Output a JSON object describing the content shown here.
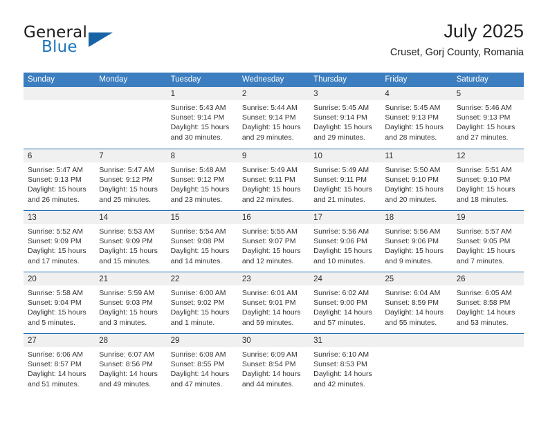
{
  "brand": {
    "name_top": "General",
    "name_bottom": "Blue",
    "triangle_color": "#1763A6",
    "blue_color": "#1F76BC"
  },
  "header": {
    "title": "July 2025",
    "subtitle": "Cruset, Gorj County, Romania"
  },
  "theme": {
    "header_bar": "#3C7EBF",
    "week_separator": "#1F6FB5",
    "daynum_strip": "#F0F0F0"
  },
  "weekdays": [
    "Sunday",
    "Monday",
    "Tuesday",
    "Wednesday",
    "Thursday",
    "Friday",
    "Saturday"
  ],
  "weeks": [
    [
      {
        "day": "",
        "empty": true
      },
      {
        "day": "",
        "empty": true
      },
      {
        "day": "1",
        "sunrise": "Sunrise: 5:43 AM",
        "sunset": "Sunset: 9:14 PM",
        "daylight1": "Daylight: 15 hours",
        "daylight2": "and 30 minutes."
      },
      {
        "day": "2",
        "sunrise": "Sunrise: 5:44 AM",
        "sunset": "Sunset: 9:14 PM",
        "daylight1": "Daylight: 15 hours",
        "daylight2": "and 29 minutes."
      },
      {
        "day": "3",
        "sunrise": "Sunrise: 5:45 AM",
        "sunset": "Sunset: 9:14 PM",
        "daylight1": "Daylight: 15 hours",
        "daylight2": "and 29 minutes."
      },
      {
        "day": "4",
        "sunrise": "Sunrise: 5:45 AM",
        "sunset": "Sunset: 9:13 PM",
        "daylight1": "Daylight: 15 hours",
        "daylight2": "and 28 minutes."
      },
      {
        "day": "5",
        "sunrise": "Sunrise: 5:46 AM",
        "sunset": "Sunset: 9:13 PM",
        "daylight1": "Daylight: 15 hours",
        "daylight2": "and 27 minutes."
      }
    ],
    [
      {
        "day": "6",
        "sunrise": "Sunrise: 5:47 AM",
        "sunset": "Sunset: 9:13 PM",
        "daylight1": "Daylight: 15 hours",
        "daylight2": "and 26 minutes."
      },
      {
        "day": "7",
        "sunrise": "Sunrise: 5:47 AM",
        "sunset": "Sunset: 9:12 PM",
        "daylight1": "Daylight: 15 hours",
        "daylight2": "and 25 minutes."
      },
      {
        "day": "8",
        "sunrise": "Sunrise: 5:48 AM",
        "sunset": "Sunset: 9:12 PM",
        "daylight1": "Daylight: 15 hours",
        "daylight2": "and 23 minutes."
      },
      {
        "day": "9",
        "sunrise": "Sunrise: 5:49 AM",
        "sunset": "Sunset: 9:11 PM",
        "daylight1": "Daylight: 15 hours",
        "daylight2": "and 22 minutes."
      },
      {
        "day": "10",
        "sunrise": "Sunrise: 5:49 AM",
        "sunset": "Sunset: 9:11 PM",
        "daylight1": "Daylight: 15 hours",
        "daylight2": "and 21 minutes."
      },
      {
        "day": "11",
        "sunrise": "Sunrise: 5:50 AM",
        "sunset": "Sunset: 9:10 PM",
        "daylight1": "Daylight: 15 hours",
        "daylight2": "and 20 minutes."
      },
      {
        "day": "12",
        "sunrise": "Sunrise: 5:51 AM",
        "sunset": "Sunset: 9:10 PM",
        "daylight1": "Daylight: 15 hours",
        "daylight2": "and 18 minutes."
      }
    ],
    [
      {
        "day": "13",
        "sunrise": "Sunrise: 5:52 AM",
        "sunset": "Sunset: 9:09 PM",
        "daylight1": "Daylight: 15 hours",
        "daylight2": "and 17 minutes."
      },
      {
        "day": "14",
        "sunrise": "Sunrise: 5:53 AM",
        "sunset": "Sunset: 9:09 PM",
        "daylight1": "Daylight: 15 hours",
        "daylight2": "and 15 minutes."
      },
      {
        "day": "15",
        "sunrise": "Sunrise: 5:54 AM",
        "sunset": "Sunset: 9:08 PM",
        "daylight1": "Daylight: 15 hours",
        "daylight2": "and 14 minutes."
      },
      {
        "day": "16",
        "sunrise": "Sunrise: 5:55 AM",
        "sunset": "Sunset: 9:07 PM",
        "daylight1": "Daylight: 15 hours",
        "daylight2": "and 12 minutes."
      },
      {
        "day": "17",
        "sunrise": "Sunrise: 5:56 AM",
        "sunset": "Sunset: 9:06 PM",
        "daylight1": "Daylight: 15 hours",
        "daylight2": "and 10 minutes."
      },
      {
        "day": "18",
        "sunrise": "Sunrise: 5:56 AM",
        "sunset": "Sunset: 9:06 PM",
        "daylight1": "Daylight: 15 hours",
        "daylight2": "and 9 minutes."
      },
      {
        "day": "19",
        "sunrise": "Sunrise: 5:57 AM",
        "sunset": "Sunset: 9:05 PM",
        "daylight1": "Daylight: 15 hours",
        "daylight2": "and 7 minutes."
      }
    ],
    [
      {
        "day": "20",
        "sunrise": "Sunrise: 5:58 AM",
        "sunset": "Sunset: 9:04 PM",
        "daylight1": "Daylight: 15 hours",
        "daylight2": "and 5 minutes."
      },
      {
        "day": "21",
        "sunrise": "Sunrise: 5:59 AM",
        "sunset": "Sunset: 9:03 PM",
        "daylight1": "Daylight: 15 hours",
        "daylight2": "and 3 minutes."
      },
      {
        "day": "22",
        "sunrise": "Sunrise: 6:00 AM",
        "sunset": "Sunset: 9:02 PM",
        "daylight1": "Daylight: 15 hours",
        "daylight2": "and 1 minute."
      },
      {
        "day": "23",
        "sunrise": "Sunrise: 6:01 AM",
        "sunset": "Sunset: 9:01 PM",
        "daylight1": "Daylight: 14 hours",
        "daylight2": "and 59 minutes."
      },
      {
        "day": "24",
        "sunrise": "Sunrise: 6:02 AM",
        "sunset": "Sunset: 9:00 PM",
        "daylight1": "Daylight: 14 hours",
        "daylight2": "and 57 minutes."
      },
      {
        "day": "25",
        "sunrise": "Sunrise: 6:04 AM",
        "sunset": "Sunset: 8:59 PM",
        "daylight1": "Daylight: 14 hours",
        "daylight2": "and 55 minutes."
      },
      {
        "day": "26",
        "sunrise": "Sunrise: 6:05 AM",
        "sunset": "Sunset: 8:58 PM",
        "daylight1": "Daylight: 14 hours",
        "daylight2": "and 53 minutes."
      }
    ],
    [
      {
        "day": "27",
        "sunrise": "Sunrise: 6:06 AM",
        "sunset": "Sunset: 8:57 PM",
        "daylight1": "Daylight: 14 hours",
        "daylight2": "and 51 minutes."
      },
      {
        "day": "28",
        "sunrise": "Sunrise: 6:07 AM",
        "sunset": "Sunset: 8:56 PM",
        "daylight1": "Daylight: 14 hours",
        "daylight2": "and 49 minutes."
      },
      {
        "day": "29",
        "sunrise": "Sunrise: 6:08 AM",
        "sunset": "Sunset: 8:55 PM",
        "daylight1": "Daylight: 14 hours",
        "daylight2": "and 47 minutes."
      },
      {
        "day": "30",
        "sunrise": "Sunrise: 6:09 AM",
        "sunset": "Sunset: 8:54 PM",
        "daylight1": "Daylight: 14 hours",
        "daylight2": "and 44 minutes."
      },
      {
        "day": "31",
        "sunrise": "Sunrise: 6:10 AM",
        "sunset": "Sunset: 8:53 PM",
        "daylight1": "Daylight: 14 hours",
        "daylight2": "and 42 minutes."
      },
      {
        "day": "",
        "empty": true
      },
      {
        "day": "",
        "empty": true
      }
    ]
  ]
}
